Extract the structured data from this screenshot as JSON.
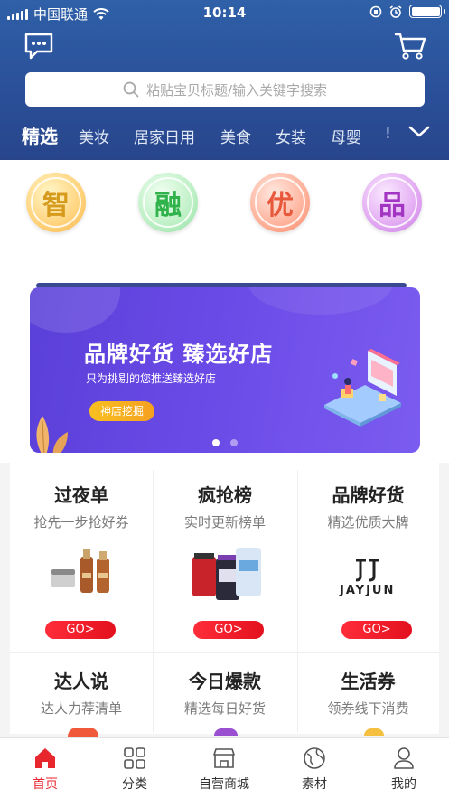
{
  "status_bar": {
    "carrier": "中国联通",
    "time": "10:14"
  },
  "search": {
    "placeholder": "粘贴宝贝标题/输入关键字搜索"
  },
  "category_tabs": [
    {
      "label": "精选",
      "active": true
    },
    {
      "label": "美妆",
      "active": false
    },
    {
      "label": "居家日用",
      "active": false
    },
    {
      "label": "美食",
      "active": false
    },
    {
      "label": "女装",
      "active": false
    },
    {
      "label": "母婴",
      "active": false
    },
    {
      "label": "!",
      "active": false
    }
  ],
  "feature_circles": [
    {
      "label": "智",
      "color": "#d69b1c"
    },
    {
      "label": "融",
      "color": "#2fb34a"
    },
    {
      "label": "优",
      "color": "#e8583c"
    },
    {
      "label": "品",
      "color": "#a236c2"
    }
  ],
  "banner": {
    "title": "品牌好货 臻选好店",
    "subtitle": "只为挑剔的您推送臻选好店",
    "button": "神店挖掘",
    "pages": 2,
    "current_page": 1
  },
  "grid": {
    "row1": [
      {
        "title": "过夜单",
        "subtitle": "抢先一步抢好券",
        "go": "GO>",
        "image": "skincare-bottles"
      },
      {
        "title": "疯抢榜",
        "subtitle": "实时更新榜单",
        "go": "GO>",
        "image": "protein-supplements"
      },
      {
        "title": "品牌好货",
        "subtitle": "精选优质大牌",
        "go": "GO>",
        "brand": "JAYJUN"
      }
    ],
    "row2": [
      {
        "title": "达人说",
        "subtitle": "达人力荐清单"
      },
      {
        "title": "今日爆款",
        "subtitle": "精选每日好货"
      },
      {
        "title": "生活券",
        "subtitle": "领券线下消费"
      }
    ]
  },
  "tab_bar": [
    {
      "label": "首页",
      "icon": "home-icon",
      "active": true
    },
    {
      "label": "分类",
      "icon": "category-grid-icon",
      "active": false
    },
    {
      "label": "自营商城",
      "icon": "store-icon",
      "active": false
    },
    {
      "label": "素材",
      "icon": "globe-icon",
      "active": false
    },
    {
      "label": "我的",
      "icon": "profile-icon",
      "active": false
    }
  ],
  "colors": {
    "header_blue": "#2a4f98",
    "accent_red": "#e8262e",
    "banner_purple": "#6a4ae6"
  }
}
